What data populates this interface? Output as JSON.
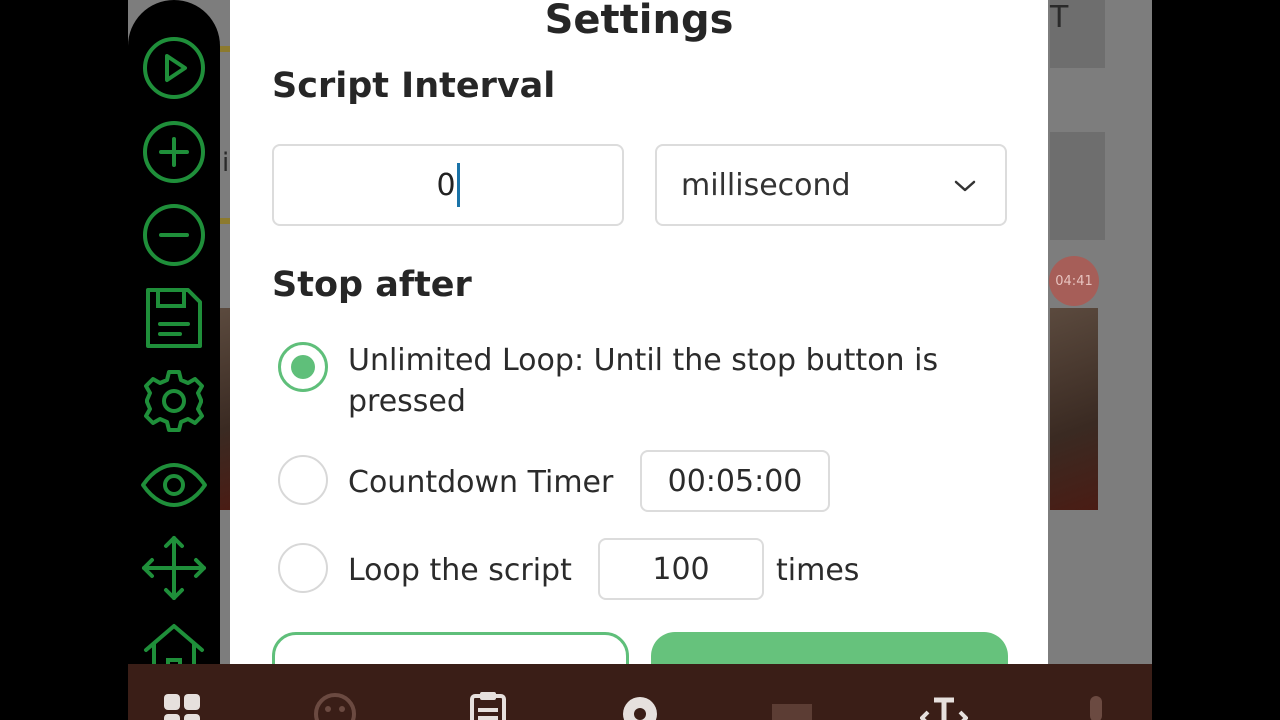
{
  "dialog": {
    "title": "Settings",
    "script_interval": {
      "heading": "Script Interval",
      "value": "0",
      "unit": "millisecond"
    },
    "stop_after": {
      "heading": "Stop after",
      "options": [
        {
          "label_line1": "Unlimited Loop: Until the stop button is",
          "label_line2": "pressed",
          "selected": true
        },
        {
          "label": "Countdown Timer",
          "value": "00:05:00",
          "selected": false
        },
        {
          "label": "Loop the script",
          "value": "100",
          "suffix": "times",
          "selected": false
        }
      ]
    }
  },
  "background": {
    "badge_time": "04:41"
  },
  "floating_toolbar": {
    "icons": [
      "play-icon",
      "plus-icon",
      "minus-icon",
      "save-icon",
      "gear-icon",
      "eye-icon",
      "move-icon",
      "home-icon"
    ],
    "accent_color": "#1f8f3a"
  },
  "bottom_bar": {
    "icons": [
      "grid-icon",
      "emoji-icon",
      "clipboard-icon",
      "gear-icon",
      "gif-icon",
      "text-cursor-icon",
      "mic-icon"
    ]
  },
  "colors": {
    "accent_green": "#5fbf7a",
    "bottom_bar_bg": "#3a1e17"
  }
}
